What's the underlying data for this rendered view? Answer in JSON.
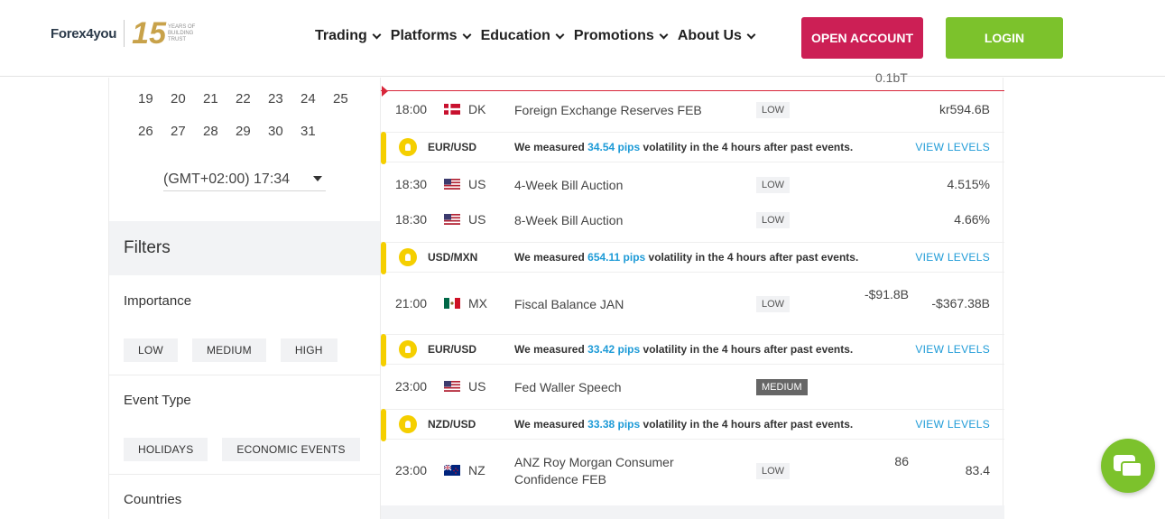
{
  "header": {
    "logo_text": "Forex4you",
    "logo_badge_number": "15",
    "logo_badge_text": "YEARS OF BUILDING TRUST",
    "nav": [
      "Trading",
      "Platforms",
      "Education",
      "Promotions",
      "About Us"
    ],
    "open_account": "OPEN ACCOUNT",
    "login": "LOGIN"
  },
  "sidebar": {
    "calendar_rows": [
      [
        "19",
        "20",
        "21",
        "22",
        "23",
        "24",
        "25"
      ],
      [
        "26",
        "27",
        "28",
        "29",
        "30",
        "31"
      ]
    ],
    "timezone": "(GMT+02:00) 17:34",
    "filters_title": "Filters",
    "importance_label": "Importance",
    "importance_chips": [
      "LOW",
      "MEDIUM",
      "HIGH"
    ],
    "event_type_label": "Event Type",
    "event_type_chips": [
      "HOLIDAYS",
      "ECONOMIC EVENTS"
    ],
    "countries_label": "Countries"
  },
  "events": {
    "cut_top_text": "0.1bT",
    "rows": [
      {
        "time": "18:00",
        "country": "DK",
        "event": "Foreign Exchange Reserves FEB",
        "importance": "LOW",
        "forecast": "",
        "actual": "kr594.6B"
      },
      {
        "time": "18:30",
        "country": "US",
        "event": "4-Week Bill Auction",
        "importance": "LOW",
        "forecast": "",
        "actual": "4.515%"
      },
      {
        "time": "18:30",
        "country": "US",
        "event": "8-Week Bill Auction",
        "importance": "LOW",
        "forecast": "",
        "actual": "4.66%"
      },
      {
        "time": "21:00",
        "country": "MX",
        "event": "Fiscal Balance JAN",
        "importance": "LOW",
        "forecast": "-$91.8B",
        "actual": "-$367.38B"
      },
      {
        "time": "23:00",
        "country": "US",
        "event": "Fed Waller Speech",
        "importance": "MEDIUM",
        "forecast": "",
        "actual": ""
      },
      {
        "time": "23:00",
        "country": "NZ",
        "event": "ANZ Roy Morgan Consumer Confidence FEB",
        "importance": "LOW",
        "forecast": "86",
        "actual": "83.4"
      }
    ],
    "volatility": [
      {
        "pair": "EUR/USD",
        "msg_before": "We measured",
        "pips": "34.54 pips",
        "msg_after": "volatility in the 4 hours after past events.",
        "link": "VIEW LEVELS"
      },
      {
        "pair": "USD/MXN",
        "msg_before": "We measured",
        "pips": "654.11 pips",
        "msg_after": "volatility in the 4 hours after past events.",
        "link": "VIEW LEVELS"
      },
      {
        "pair": "EUR/USD",
        "msg_before": "We measured",
        "pips": "33.42 pips",
        "msg_after": "volatility in the 4 hours after past events.",
        "link": "VIEW LEVELS"
      },
      {
        "pair": "NZD/USD",
        "msg_before": "We measured",
        "pips": "33.38 pips",
        "msg_after": "volatility in the 4 hours after past events.",
        "link": "VIEW LEVELS"
      }
    ]
  },
  "colors": {
    "open_account": "#cc1f55",
    "login": "#7cc22c",
    "volatility_bar": "#f5cf00",
    "link": "#1e9bd7",
    "red_line": "#d8263a"
  },
  "icons": {
    "chat": "chat-bubbles-icon",
    "bulb": "lightbulb-icon",
    "caret": "caret-down-icon"
  }
}
